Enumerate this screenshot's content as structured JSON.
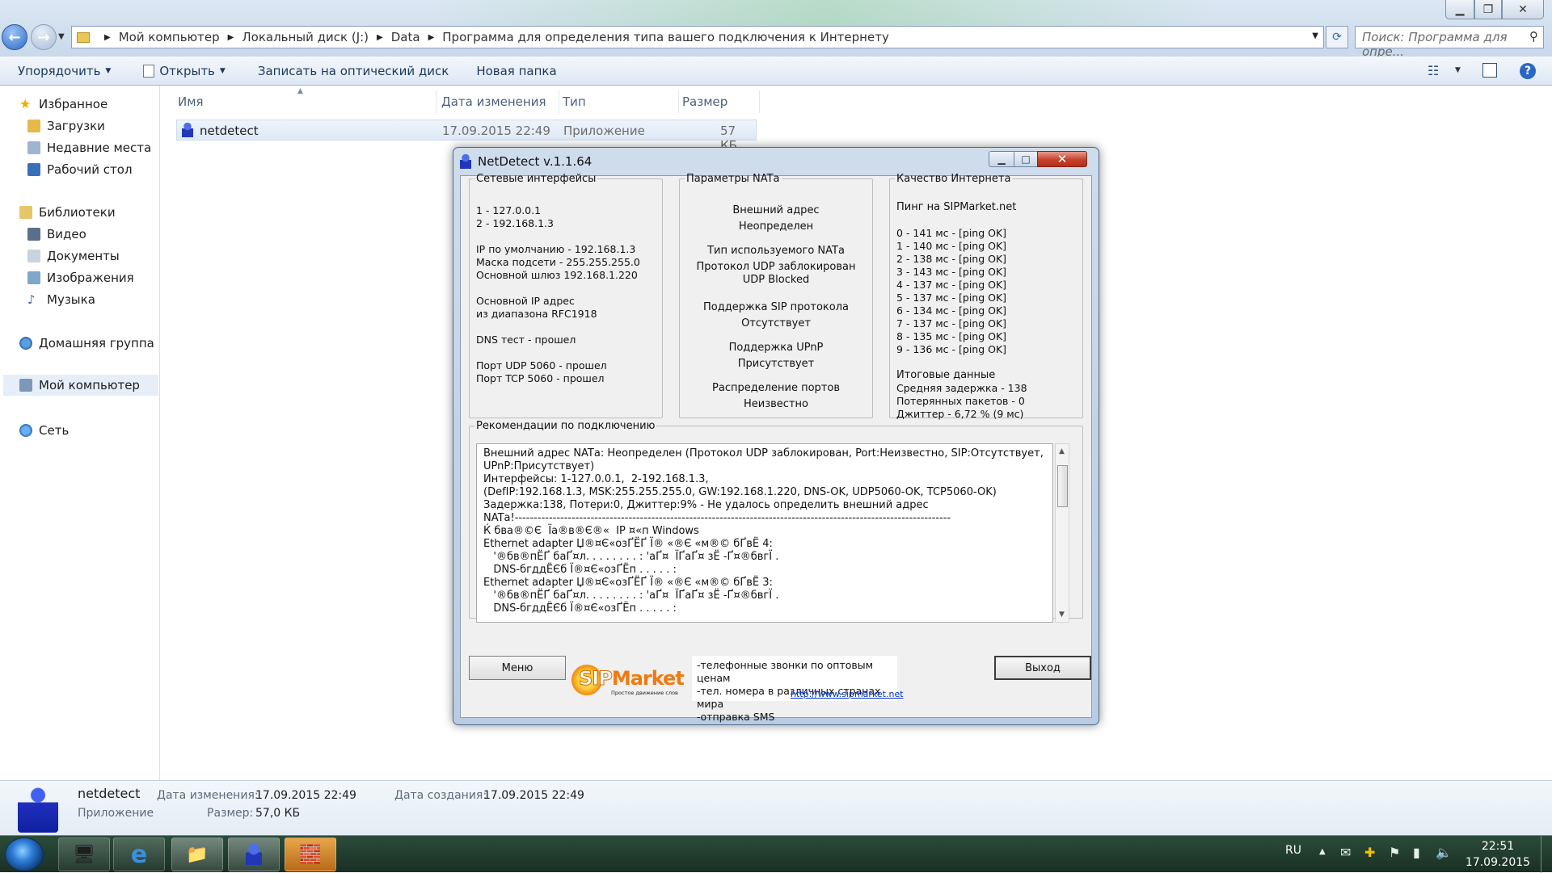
{
  "explorer": {
    "breadcrumb": [
      "Мой компьютер",
      "Локальный диск (J:)",
      "Data",
      "Программа для определения типа вашего подключения к Интернету"
    ],
    "search_placeholder": "Поиск: Программа для опре...",
    "toolbar": {
      "organize": "Упорядочить",
      "open": "Открыть",
      "burn": "Записать на оптический диск",
      "new_folder": "Новая папка"
    },
    "nav": {
      "favorites": "Избранное",
      "downloads": "Загрузки",
      "recent": "Недавние места",
      "desktop": "Рабочий стол",
      "libraries": "Библиотеки",
      "video": "Видео",
      "documents": "Документы",
      "images": "Изображения",
      "music": "Музыка",
      "homegroup": "Домашняя группа",
      "computer": "Мой компьютер",
      "network": "Сеть"
    },
    "columns": {
      "name": "Имя",
      "modified": "Дата изменения",
      "type": "Тип",
      "size": "Размер"
    },
    "file": {
      "name": "netdetect",
      "modified": "17.09.2015 22:49",
      "type": "Приложение",
      "size": "57 КБ"
    },
    "details": {
      "name": "netdetect",
      "type": "Приложение",
      "modified_label": "Дата изменения:",
      "modified": "17.09.2015 22:49",
      "size_label": "Размер:",
      "size": "57,0 КБ",
      "created_label": "Дата создания:",
      "created": "17.09.2015 22:49"
    }
  },
  "netdetect": {
    "title": "NetDetect  v.1.1.64",
    "interfaces": {
      "legend": "Сетевые интерфейсы",
      "lines": [
        "1 - 127.0.0.1",
        "2 - 192.168.1.3",
        "IP по умолчанию - 192.168.1.3",
        "Маска подсети - 255.255.255.0",
        "Основной шлюз 192.168.1.220",
        "Основной IP адрес",
        "из диапазона RFC1918",
        "DNS тест - прошел",
        "Порт UDP 5060 - прошел",
        "Порт TCP 5060 - прошел"
      ]
    },
    "nat": {
      "legend": "Параметры NATа",
      "lines": [
        "Внешний адрес",
        "Неопределен",
        "Тип используемого NATа",
        "Протокол UDP заблокирован",
        "UDP Blocked",
        "Поддержка SIP протокола",
        "Отсутствует",
        "Поддержка UPnP",
        "Присутствует",
        "Распределение портов",
        "Неизвестно"
      ]
    },
    "quality": {
      "legend": "Качество Интернета",
      "ping_title": "Пинг на SIPMarket.net",
      "pings": [
        "0 - 141 мс -  [ping OK]",
        "1 - 140 мс -  [ping OK]",
        "2 - 138 мс -  [ping OK]",
        "3 - 143 мс -  [ping OK]",
        "4 - 137 мс -  [ping OK]",
        "5 - 137 мс -  [ping OK]",
        "6 - 134 мс -  [ping OK]",
        "7 - 137 мс -  [ping OK]",
        "8 - 135 мс -  [ping OK]",
        "9 - 136 мс -  [ping OK]"
      ],
      "summary": [
        "Итоговые данные",
        "Средняя задержка - 138",
        "Потерянных пакетов - 0",
        "Джиттер - 6,72 %  (9 мс)"
      ]
    },
    "recommendations": {
      "legend": "Рекомендации по подключению",
      "lines": [
        "Внешний адрес NATа: Неопределен (Протокол UDP заблокирован, Port:Неизвестно, SIP:Отсутствует,",
        "UPnP:Присутствует)",
        "Интерфейсы: 1-127.0.0.1,  2-192.168.1.3,",
        "(DefIP:192.168.1.3, MSK:255.255.255.0, GW:192.168.1.220, DNS-OK, UDP5060-OK, TCP5060-OK)",
        "Задержка:138, Потери:0, Джиттер:9% - Не удалось определить внешний адрес",
        "NATа!-------------------------------------------------------------------------------------------------------------------",
        "Ќ бва®©Є  Їа®в®Є®«  IP ¤«п Windows",
        "Ethernet adapter Џ®¤Є«озҐ­ЁҐ Ї® «®Є «м­®© бҐвЁ 4:",
        "   '®бв®п­ЁҐ баҐ¤л. . . . . . . . : 'аҐ¤  ЇҐаҐ¤ зЁ -Ґ¤®бвгЇ­ .",
        "   DNS-бгддЁЄб Ї®¤Є«озҐ­Ёп . . . . . :",
        "Ethernet adapter Џ®¤Є«озҐ­ЁҐ Ї® «®Є «м­®© бҐвЁ 3:",
        "   '®бв®п­ЁҐ баҐ¤л. . . . . . . . : 'аҐ¤  ЇҐаҐ¤ зЁ -Ґ¤®бвгЇ­ .",
        "   DNS-бгддЁЄб Ї®¤Є«озҐ­Ёп . . . . . :"
      ]
    },
    "menu_button": "Меню",
    "exit_button": "Выход",
    "logo": {
      "sip": "SIP",
      "market": "Market",
      "tagline": "Простое движение слов"
    },
    "promo": [
      "-телефонные звонки по оптовым ценам",
      "-тел. номера в различных странах мира",
      "-отправка SMS"
    ],
    "promo_link": "http://www.sipmarket.net"
  },
  "taskbar": {
    "lang": "RU",
    "time": "22:51",
    "date": "17.09.2015"
  }
}
